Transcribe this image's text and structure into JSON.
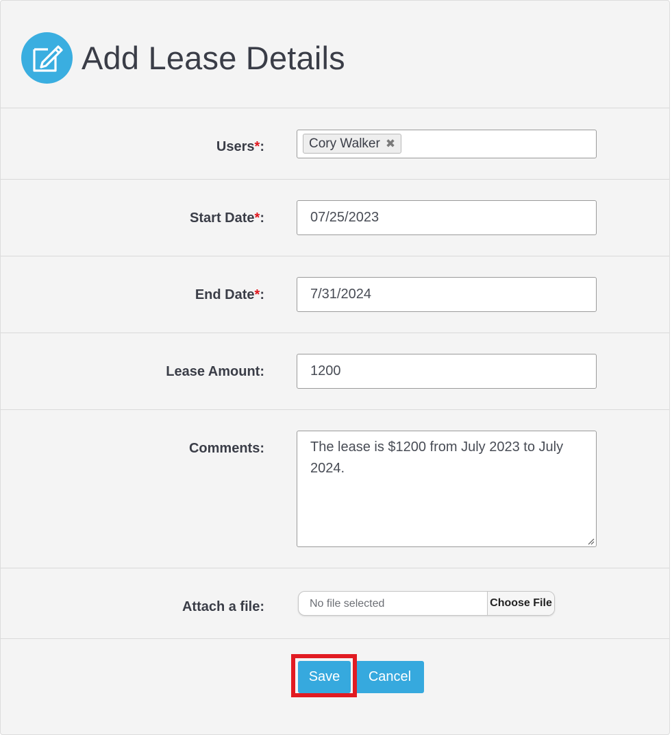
{
  "header": {
    "title": "Add Lease Details",
    "icon": "edit-icon"
  },
  "form": {
    "users": {
      "label": "Users",
      "required_mark": "*",
      "colon": ":",
      "selected_user": "Cory Walker",
      "remove_icon": "✖"
    },
    "start_date": {
      "label": "Start Date",
      "required_mark": "*",
      "colon": ":",
      "value": "07/25/2023"
    },
    "end_date": {
      "label": "End Date",
      "required_mark": "*",
      "colon": ":",
      "value": "7/31/2024"
    },
    "lease_amount": {
      "label": "Lease Amount:",
      "value": "1200"
    },
    "comments": {
      "label": "Comments:",
      "value": "The lease is $1200 from July 2023 to July 2024."
    },
    "attach": {
      "label": "Attach a file:",
      "file_status": "No file selected",
      "button_label": "Choose File"
    }
  },
  "actions": {
    "save_label": "Save",
    "cancel_label": "Cancel"
  },
  "colors": {
    "accent": "#36a9de",
    "required": "#e0161d",
    "highlight": "#e11b22",
    "panel_bg": "#f4f4f4"
  }
}
